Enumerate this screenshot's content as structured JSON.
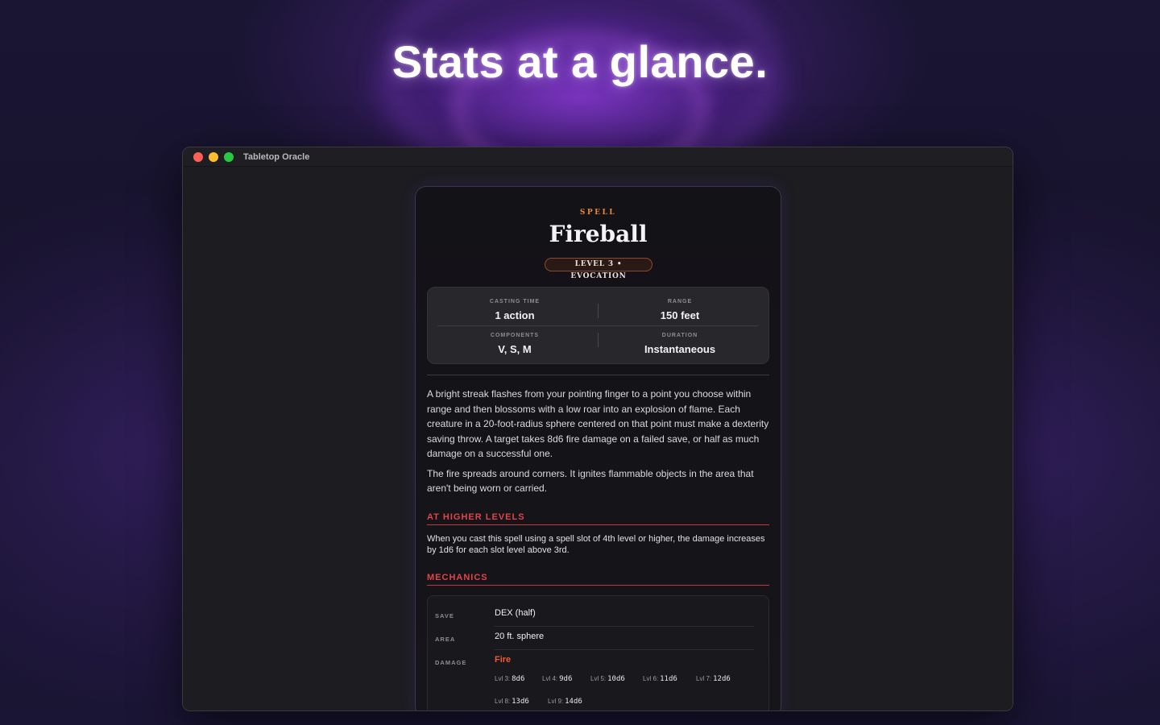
{
  "headline": "Stats at a glance.",
  "window": {
    "title": "Tabletop Oracle"
  },
  "spell": {
    "kind": "SPELL",
    "name": "Fireball",
    "badge": "LEVEL 3 • EVOCATION",
    "stats": {
      "casting_time_label": "CASTING TIME",
      "casting_time": "1 action",
      "range_label": "RANGE",
      "range": "150 feet",
      "components_label": "COMPONENTS",
      "components": "V, S, M",
      "duration_label": "DURATION",
      "duration": "Instantaneous"
    },
    "description": [
      "A bright streak flashes from your pointing finger to a point you choose within range and then blossoms with a low roar into an explosion of flame. Each creature in a 20-foot-radius sphere centered on that point must make a dexterity saving throw. A target takes 8d6 fire damage on a failed save, or half as much damage on a successful one.",
      "The fire spreads around corners. It ignites flammable objects in the area that aren't being worn or carried."
    ],
    "higher_levels_heading": "AT HIGHER LEVELS",
    "higher_levels_text": "When you cast this spell using a spell slot of 4th level or higher, the damage increases by 1d6 for each slot level above 3rd.",
    "mechanics_heading": "MECHANICS",
    "mechanics": {
      "save_label": "SAVE",
      "save": "DEX (half)",
      "area_label": "AREA",
      "area": "20 ft. sphere",
      "damage_label": "DAMAGE",
      "damage_type": "Fire",
      "damage_levels": [
        {
          "label": "Lvl 3:",
          "dice": "8d6"
        },
        {
          "label": "Lvl 4:",
          "dice": "9d6"
        },
        {
          "label": "Lvl 5:",
          "dice": "10d6"
        },
        {
          "label": "Lvl 6:",
          "dice": "11d6"
        },
        {
          "label": "Lvl 7:",
          "dice": "12d6"
        },
        {
          "label": "Lvl 8:",
          "dice": "13d6"
        },
        {
          "label": "Lvl 9:",
          "dice": "14d6"
        }
      ]
    }
  },
  "colors": {
    "accent_orange": "#e8893a",
    "section_red": "#e0454a",
    "fire": "#ef5a35"
  }
}
